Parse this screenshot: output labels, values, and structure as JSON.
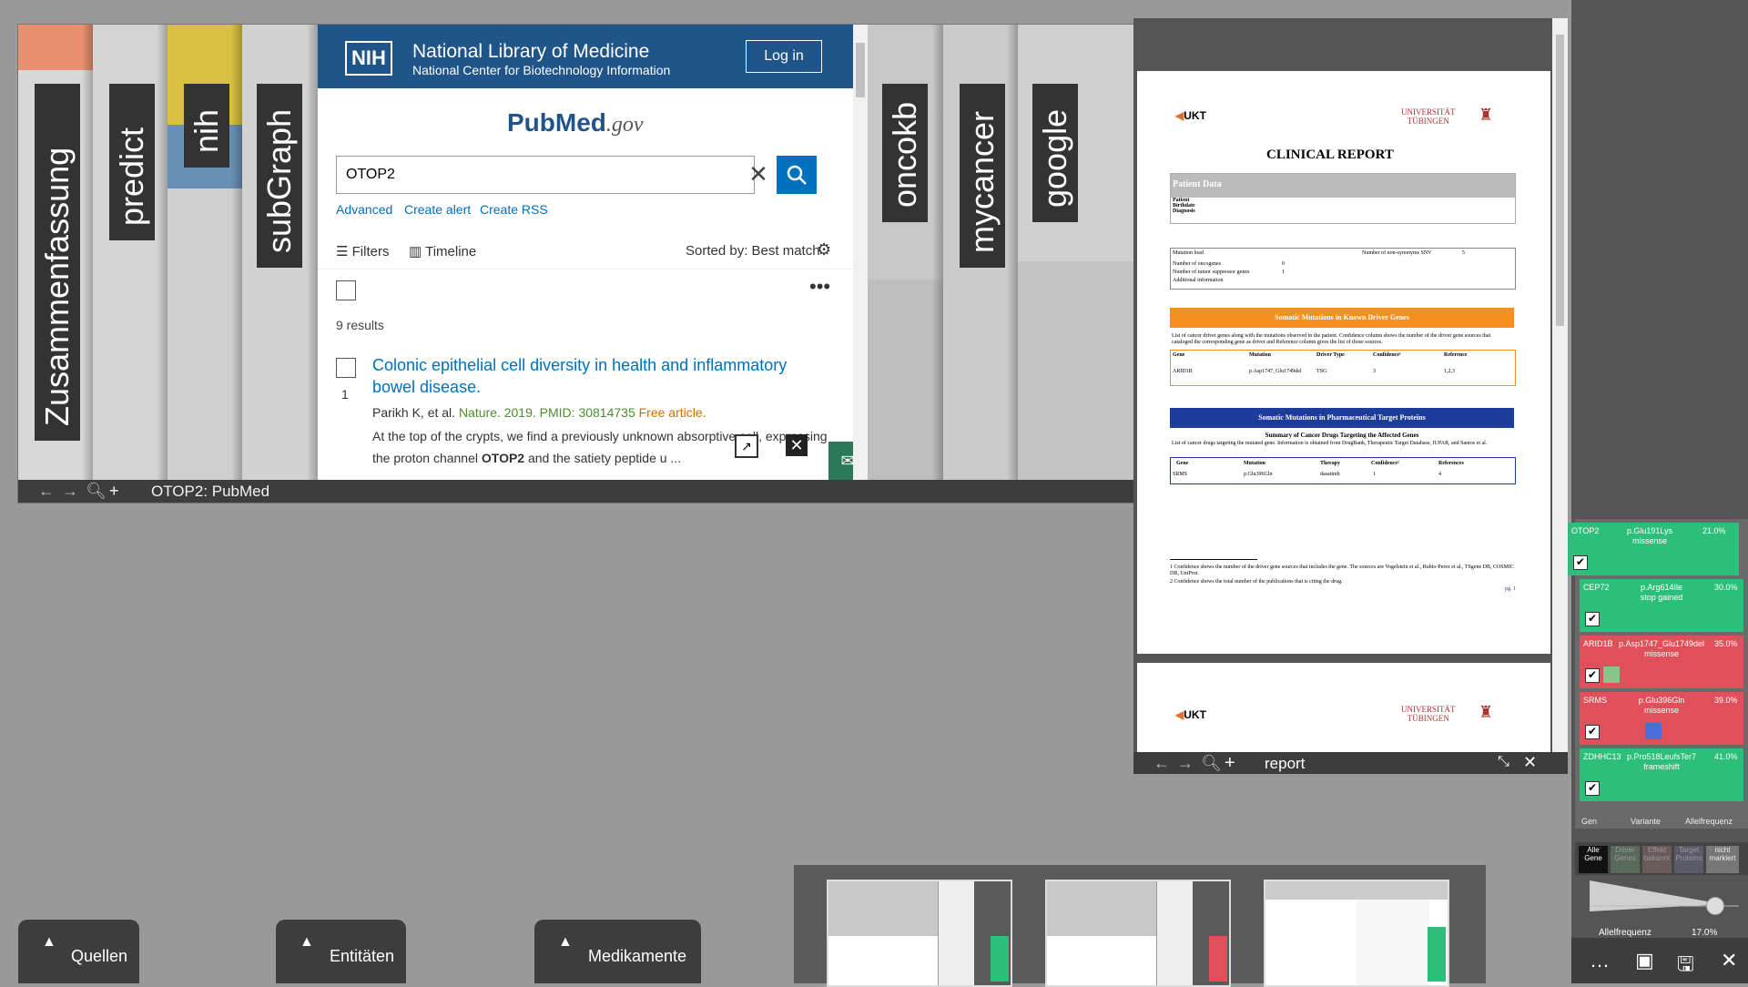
{
  "browser": {
    "tabs": [
      {
        "label": "Zusammenfassung"
      },
      {
        "label": "predict"
      },
      {
        "label": "nih"
      },
      {
        "label": "subGraph"
      },
      {
        "label": "oncokb"
      },
      {
        "label": "mycancer"
      },
      {
        "label": "google"
      }
    ],
    "title": "OTOP2: PubMed"
  },
  "pubmed": {
    "nih_badge": "NIH",
    "nlm_title": "National Library of Medicine",
    "nlm_subtitle": "National Center for Biotechnology Information",
    "login_label": "Log in",
    "logo_main": "PubMed",
    "logo_gov": ".gov",
    "search_value": "OTOP2",
    "links": [
      "Advanced",
      "Create alert",
      "Create RSS"
    ],
    "filters_label": "Filters",
    "timeline_label": "Timeline",
    "sorted_label": "Sorted by: Best match",
    "results_count": "9 results",
    "result": {
      "number": "1",
      "title": "Colonic epithelial cell diversity in health and inflammatory bowel disease.",
      "authors": "Parikh K, et al.",
      "journal": "Nature. 2019. PMID: 30814735",
      "free": "Free article.",
      "snippet_pre": "At the top of the crypts, we find a previously unknown absorptive cell, expressing the proton channel ",
      "snippet_bold": "OTOP2",
      "snippet_post": " and the satiety peptide u ..."
    }
  },
  "report": {
    "title": "report",
    "heading": "CLINICAL REPORT",
    "ukt": "UKT",
    "uni_line1": "UNIVERSITÄT",
    "uni_line2": "TÜBINGEN",
    "patient_data": "Patient Data",
    "patient_fields": [
      "Patient",
      "Birthdate",
      "Diagnosis"
    ],
    "mutation_load": "Mutation load",
    "non_syn_label": "Number of non-synonyms SNV",
    "non_syn_value": "5",
    "oncogenes_label": "Number of oncogenes",
    "oncogenes_value": "0",
    "tsg_label": "Number of tumor suppressor genes",
    "tsg_value": "1",
    "additional": "Additional information",
    "somatic_driver_title": "Somatic Mutations in Known Driver Genes",
    "driver_desc": "List of cancer driver genes along with the mutations observed in the patient. Confidence column shows the number of the driver gene sources that cataloged the corresponding gene as driver and Reference column gives the list of those sources.",
    "driver_headers": [
      "Gene",
      "Mutation",
      "Driver Type",
      "Confidence¹",
      "Reference"
    ],
    "driver_row": [
      "ARID1B",
      "p.Asp1747_Glu1749del",
      "TSG",
      "3",
      "1,2,3"
    ],
    "pharma_title": "Somatic Mutations in Pharmaceutical Target Proteins",
    "pharma_sub": "Summary of Cancer Drugs Targeting the Affected Genes",
    "pharma_desc": "List of cancer drugs targeting the mutated gene. Information is obtained from DrugBank, Therapeutic Target Database, IUPAR, and Santos et al.",
    "pharma_headers": [
      "Gene",
      "Mutation",
      "Therapy",
      "Confidence²",
      "References"
    ],
    "pharma_row": [
      "SRMS",
      "p.Glu396Gln",
      "dasatinib",
      "1",
      "4"
    ],
    "footnote1": "1 Confidence shows the number of the driver gene sources that includes the gene. The sources are Vogelstein et al., Rubio-Perez et al., TSgene DB, COSMIC DB, UniProt.",
    "footnote2": "2 Confidence shows the total number of the publications that is citing the drug.",
    "page_num": "pg. 1"
  },
  "variants": [
    {
      "gene": "OTOP2",
      "variant": "p.Glu191Lys",
      "type": "missense",
      "af": "21.0%",
      "color": "#2bbf7a"
    },
    {
      "gene": "CEP72",
      "variant": "p.Arg614Ile",
      "type": "stop gained",
      "af": "30.0%",
      "color": "#2bbf7a"
    },
    {
      "gene": "ARID1B",
      "variant": "p.Asp1747_Glu1749del",
      "type": "missense",
      "af": "35.0%",
      "color": "#e0505a"
    },
    {
      "gene": "SRMS",
      "variant": "p.Glu396Gln",
      "type": "missense",
      "af": "39.0%",
      "color": "#e0505a"
    },
    {
      "gene": "ZDHHC13",
      "variant": "p.Pro518LeufsTer7",
      "type": "frameshift",
      "af": "41.0%",
      "color": "#2bbf7a"
    }
  ],
  "variant_headers": [
    "Gen",
    "Variante",
    "Allelfrequenz"
  ],
  "filters": [
    "Alle Gene",
    "Driver Genes",
    "Effekt bekannt",
    "Target Proteins",
    "nicht markiert"
  ],
  "allelfrequenz_label": "Allelfrequenz",
  "allelfrequenz_value": "17.0%",
  "bottom": {
    "quellen": "Quellen",
    "entitaeten": "Entitäten",
    "medikamente": "Medikamente"
  }
}
